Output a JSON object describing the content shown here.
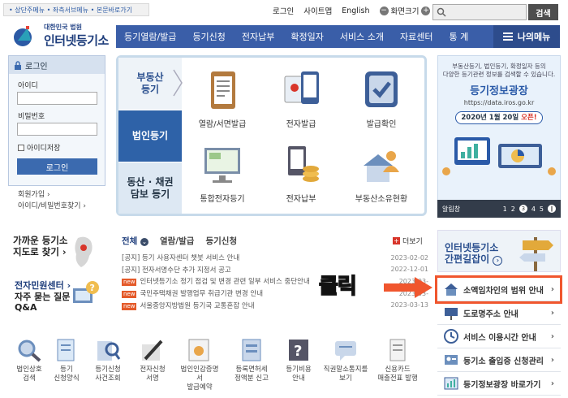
{
  "skip_links": "• 상단주메뉴 • 좌측서브메뉴 • 본문바로가기",
  "util": {
    "login": "로그인",
    "sitemap": "사이트맵",
    "english": "English",
    "zoom_label": "화면크기"
  },
  "search": {
    "button": "검색"
  },
  "logo": {
    "sub": "대한민국 법원",
    "main": "인터넷등기소"
  },
  "nav": {
    "items": [
      "등기열람/발급",
      "등기신청",
      "전자납부",
      "확정일자",
      "서비스 소개",
      "자료센터",
      "통 계"
    ],
    "my_menu": "나의메뉴"
  },
  "login": {
    "title": "로그인",
    "id_label": "아이디",
    "pw_label": "비밀번호",
    "save_id": "아이디저장",
    "button": "로그인",
    "join": "회원가입",
    "find": "아이디/비밀번호찾기"
  },
  "main_tabs": [
    {
      "label_line1": "부동산",
      "label_line2": "등기"
    },
    {
      "label_line1": "법인등기",
      "label_line2": ""
    },
    {
      "label_line1": "동산 · 채권",
      "label_line2": "담보 등기"
    }
  ],
  "tiles": [
    "열람/서면발급",
    "전자발급",
    "발급확인",
    "통합전자등기",
    "전자납부",
    "부동산소유현황"
  ],
  "banner": {
    "line1": "부동산등기, 법인등기, 확정일자 등의",
    "line2": "다양한 등기관련 정보를 검색할 수 있습니다.",
    "title": "등기정보광장",
    "url": "https://data.iros.go.kr",
    "open_date": "2020년 1월 20일",
    "open_word": "오픈!",
    "pager_label": "알림창",
    "pages": [
      "1",
      "2",
      "3",
      "4",
      "5"
    ]
  },
  "quick": {
    "find_registry_l1": "가까운 등기소",
    "find_registry_l2": "지도로 찾기",
    "civil_center": "전자민원센터",
    "faq_l1": "자주 묻는 질문",
    "faq_l2": "Q&A"
  },
  "notice": {
    "tabs": [
      "전체",
      "열람/발급",
      "등기신청"
    ],
    "more": "더보기",
    "items": [
      {
        "badge": "",
        "text": "[공지] 등기 사용자센터 챗봇 서비스 안내",
        "date": "2023-02-02"
      },
      {
        "badge": "",
        "text": "[공지] 전자서명수단 추가 지정서 공고",
        "date": "2022-12-01"
      },
      {
        "badge": "new",
        "text": "인터넷등기소 정기 점검 및 변경 관련 일부 서비스 중단안내",
        "date": "2023-03-"
      },
      {
        "badge": "new",
        "text": "국민주택채권 발행업무 취급기관 변경 안내",
        "date": "2023-03-"
      },
      {
        "badge": "new",
        "text": "서울중앙지방법원 등기국 교통혼잡 안내",
        "date": "2023-03-13"
      }
    ]
  },
  "bottom_icons": [
    {
      "l1": "법인상호",
      "l2": "검색"
    },
    {
      "l1": "등기",
      "l2": "신청양식"
    },
    {
      "l1": "등기신청",
      "l2": "사건조회"
    },
    {
      "l1": "전자신청",
      "l2": "서명"
    },
    {
      "l1": "법인인감증명서",
      "l2": "발급예약"
    },
    {
      "l1": "등록면허세",
      "l2": "정액분 신고"
    },
    {
      "l1": "등기비용",
      "l2": "안내"
    },
    {
      "l1": "직권말소통지를",
      "l2": "보기"
    },
    {
      "l1": "신용카드",
      "l2": "매출전표 발행"
    }
  ],
  "quickmenu": {
    "title_l1": "인터넷등기소",
    "title_l2": "간편길잡이",
    "items": [
      "소액임차인의 범위 안내",
      "도로명주소 안내",
      "서비스 이용시간 안내",
      "등기소 출입증 신청관리",
      "등기정보광장 바로가기"
    ]
  },
  "annotation": {
    "click_label": "클릭"
  },
  "colors": {
    "nav": "#3a5ea8",
    "highlight": "#f0562e",
    "accent_red": "#d8352a"
  }
}
